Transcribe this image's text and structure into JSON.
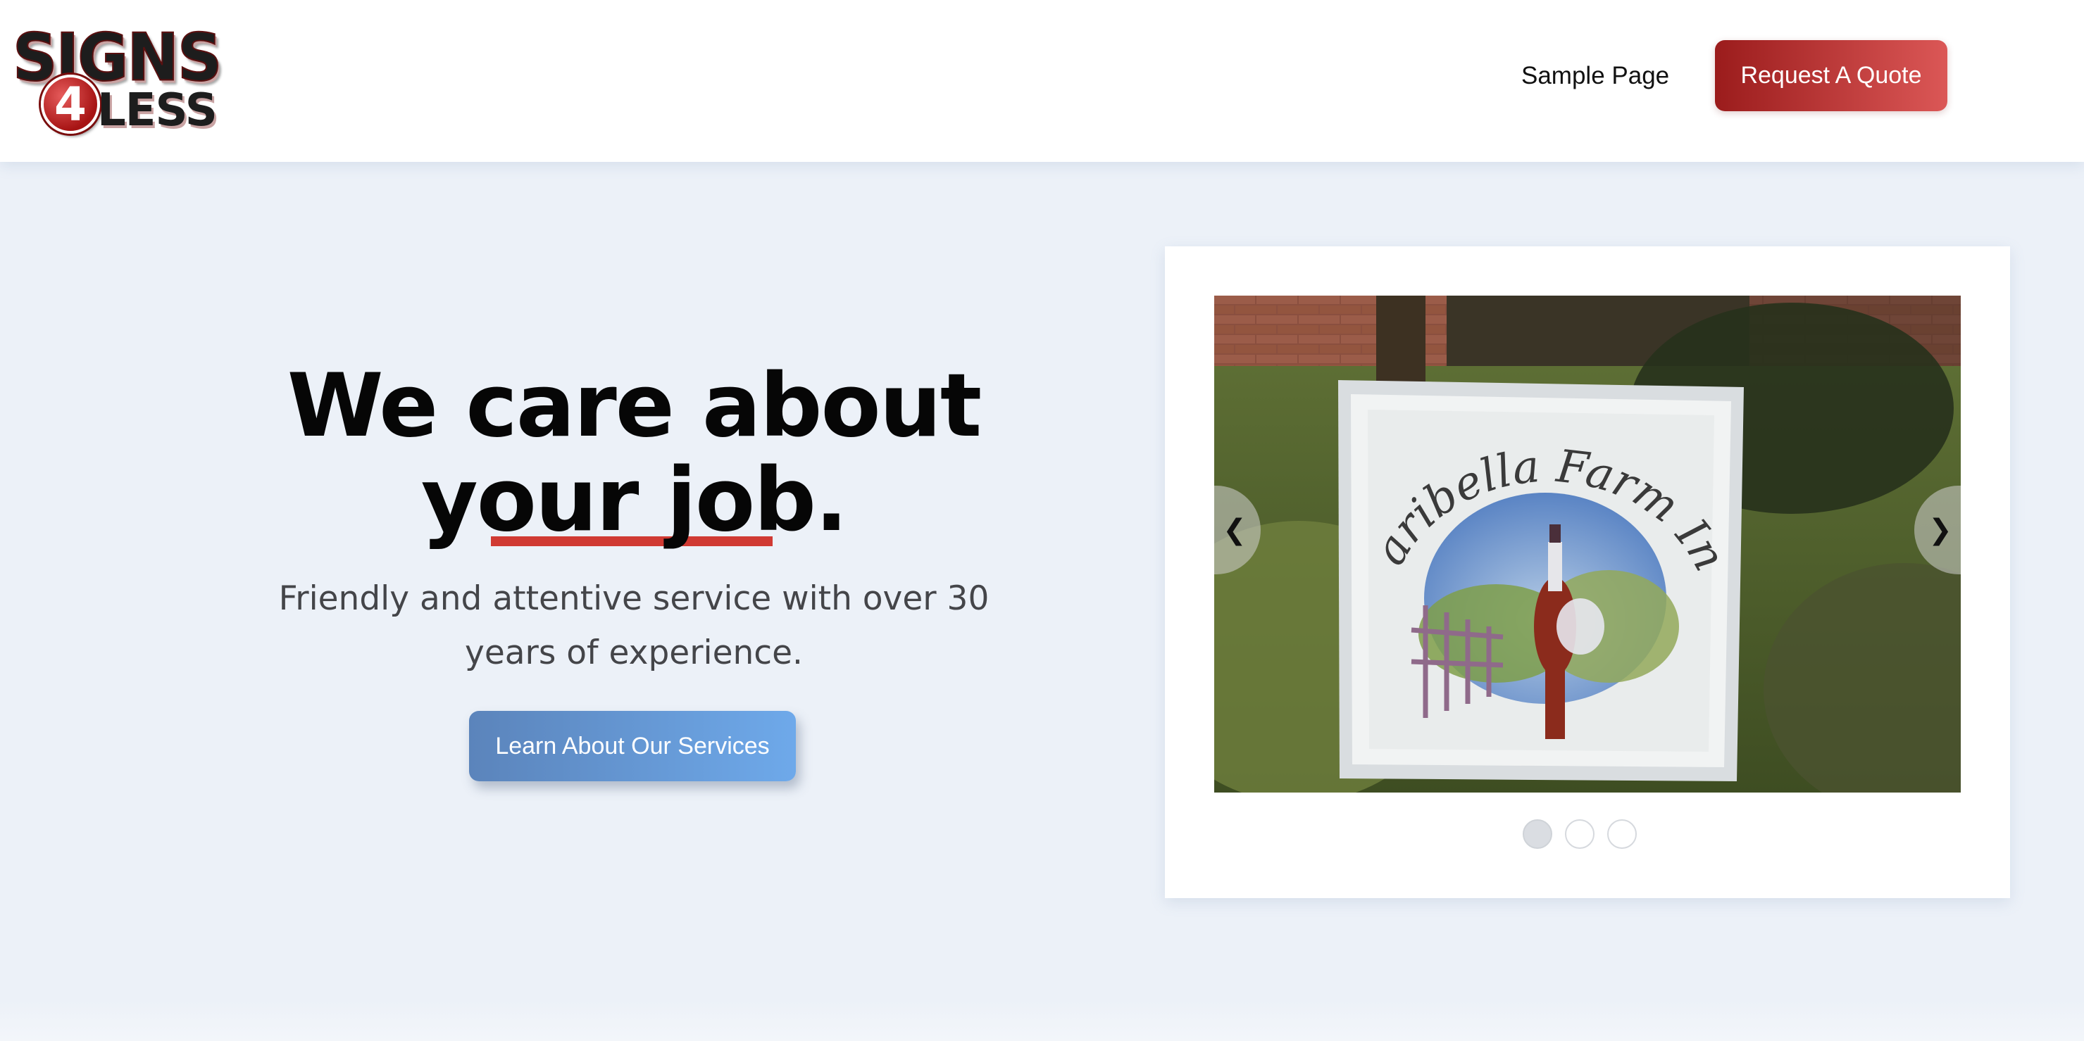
{
  "header": {
    "logo": {
      "line1": "SIGNS",
      "digit": "4",
      "line2": "LESS"
    },
    "nav_link": "Sample Page",
    "cta_label": "Request A Quote"
  },
  "hero": {
    "title_line1": "We care about",
    "title_line2": "your job.",
    "subtitle": "Friendly and attentive service with over 30 years of experience.",
    "button_label": "Learn About Our Services"
  },
  "slider": {
    "prev_arrow": "❮",
    "next_arrow": "❯",
    "slide_sign_text": "Maribella Farm Inc.",
    "slide_count": 3,
    "active_index": 0
  },
  "colors": {
    "brand_red": "#b32a2a",
    "accent_blue": "#6a9fe0",
    "page_bg": "#ecf1f8"
  }
}
